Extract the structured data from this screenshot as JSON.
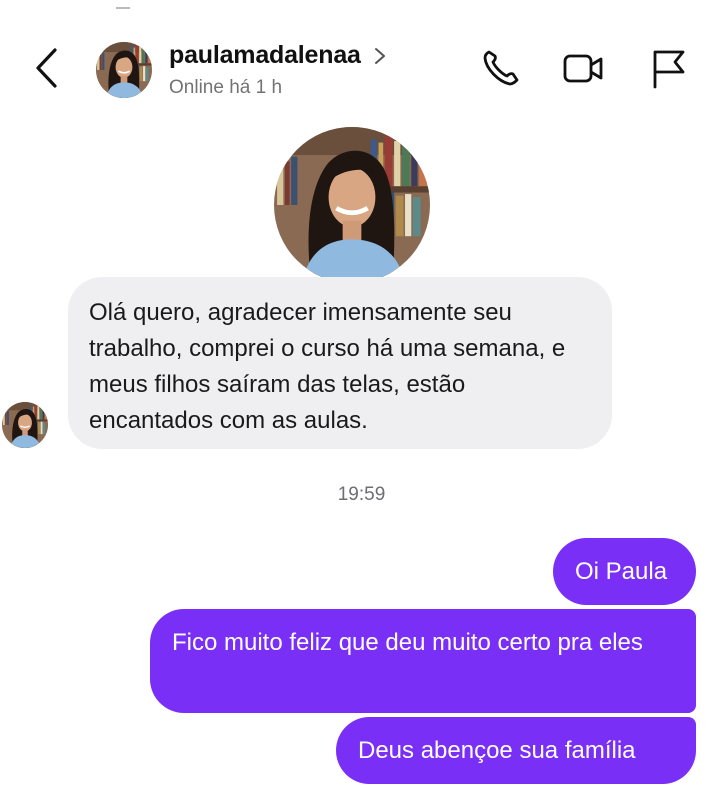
{
  "header": {
    "username": "paulamadalenaa",
    "status": "Online há 1 h",
    "icons": {
      "back": "chevron-left-icon",
      "profile_chevron": "chevron-right-icon",
      "call": "phone-icon",
      "video": "video-camera-icon",
      "report": "flag-icon"
    }
  },
  "messages": [
    {
      "direction": "incoming",
      "text": "Olá quero, agradecer imensamente seu trabalho, comprei o curso há uma semana, e meus filhos saíram das telas, estão encantados com as aulas."
    },
    {
      "direction": "timestamp",
      "text": "19:59"
    },
    {
      "direction": "outgoing",
      "text": "Oi Paula"
    },
    {
      "direction": "outgoing",
      "text": "Fico muito feliz que deu muito certo pra eles"
    },
    {
      "direction": "outgoing",
      "text": "Deus abençoe sua família"
    }
  ],
  "colors": {
    "outgoing_bubble": "#7a2ff7",
    "incoming_bubble": "#efeff2",
    "status_text": "#737373",
    "timestamp_text": "#6e6e73"
  }
}
